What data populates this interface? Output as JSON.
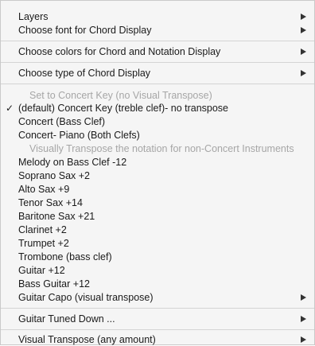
{
  "menu": {
    "items": [
      {
        "label": "Layers",
        "submenu": true
      },
      {
        "label": "Choose font for Chord Display",
        "submenu": true
      },
      {
        "label": "Choose colors for Chord and Notation Display",
        "submenu": true
      },
      {
        "label": "Choose type of Chord Display",
        "submenu": true
      },
      {
        "label": "Set to Concert Key (no Visual Transpose)",
        "disabled": true
      },
      {
        "label": "(default) Concert Key (treble clef)- no transpose",
        "checked": true,
        "check_glyph": "✓"
      },
      {
        "label": "Concert (Bass Clef)"
      },
      {
        "label": "Concert- Piano (Both Clefs)"
      },
      {
        "label": "Visually Transpose the notation for non-Concert Instruments",
        "disabled": true
      },
      {
        "label": "Melody on Bass Clef -12"
      },
      {
        "label": "Soprano Sax +2"
      },
      {
        "label": "Alto Sax +9"
      },
      {
        "label": "Tenor Sax +14"
      },
      {
        "label": "Baritone Sax +21"
      },
      {
        "label": "Clarinet +2"
      },
      {
        "label": "Trumpet +2"
      },
      {
        "label": "Trombone (bass clef)"
      },
      {
        "label": "Guitar +12"
      },
      {
        "label": "Bass Guitar +12"
      },
      {
        "label": "Guitar Capo (visual transpose)",
        "submenu": true
      },
      {
        "label": "Guitar Tuned Down ...",
        "submenu": true
      },
      {
        "label": "Visual Transpose (any amount)",
        "submenu": true
      }
    ]
  }
}
